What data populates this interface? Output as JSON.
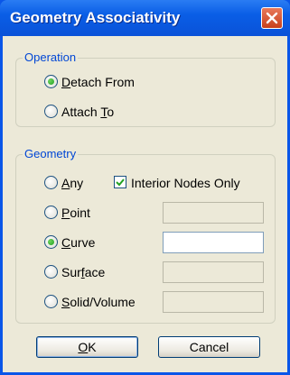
{
  "window": {
    "title": "Geometry Associativity"
  },
  "operation": {
    "legend": "Operation",
    "options": [
      {
        "pre": "",
        "key": "D",
        "post": "etach From",
        "selected": true
      },
      {
        "pre": "Attach ",
        "key": "T",
        "post": "o",
        "selected": false
      }
    ]
  },
  "geometry": {
    "legend": "Geometry",
    "options": [
      {
        "pre": "",
        "key": "A",
        "post": "ny",
        "selected": false
      },
      {
        "pre": "",
        "key": "P",
        "post": "oint",
        "selected": false
      },
      {
        "pre": "",
        "key": "C",
        "post": "urve",
        "selected": true
      },
      {
        "pre": "Sur",
        "key": "f",
        "post": "ace",
        "selected": false
      },
      {
        "pre": "",
        "key": "S",
        "post": "olid/Volume",
        "selected": false
      }
    ],
    "interior_nodes": {
      "label": "Interior Nodes Only",
      "checked": true
    },
    "fields": {
      "point": "",
      "curve": "",
      "surface": "",
      "solid": ""
    }
  },
  "buttons": {
    "ok": {
      "key": "O",
      "post": "K"
    },
    "cancel": {
      "label": "Cancel"
    }
  }
}
